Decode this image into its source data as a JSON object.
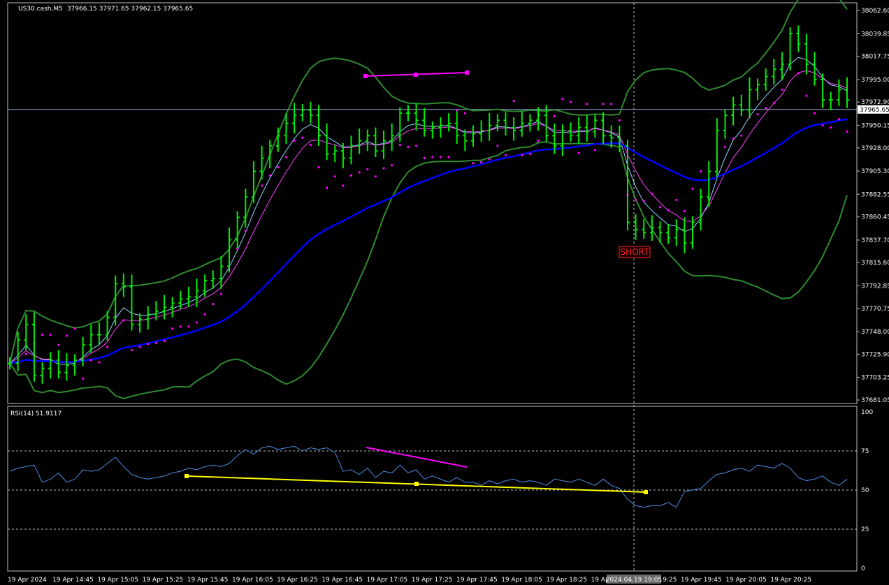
{
  "header": {
    "symbol": "US30.cash,M5",
    "ohlc": "37966.15 37971.65 37962.15 37965.65"
  },
  "rsi_header": "RSI(14) 51.9117",
  "signal_label": "SHORT",
  "crosshair_time": "2024.04.19 19:05",
  "colors": {
    "background": "#000000",
    "bars": "#00ee00",
    "bb_up": "#2e8b2e",
    "bb_down": "#ff0000",
    "ma_fast": "#8fd8ff",
    "ma_mid": "#ff40ff",
    "ma_slow": "#0000ff",
    "psar": "#ff00ff",
    "rsi_line": "#4a90e2",
    "trend_up": "#ff00ff",
    "trend_rsi": "#ffff00"
  },
  "chart_data": [
    {
      "type": "line",
      "title": "US30.cash,M5",
      "price_ticks": [
        "38062.60",
        "38039.85",
        "38017.75",
        "37995.00",
        "37972.90",
        "37950.15",
        "37928.00",
        "37905.30",
        "37882.55",
        "37860.45",
        "37837.70",
        "37815.60",
        "37792.85",
        "37770.75",
        "37748.00",
        "37725.90",
        "37703.25",
        "37681.05"
      ],
      "current_price": "37965.65",
      "ylim": [
        37681.05,
        38062.6
      ],
      "x_ticks": [
        "19 Apr 2024",
        "19 Apr 14:45",
        "19 Apr 15:05",
        "19 Apr 15:25",
        "19 Apr 15:45",
        "19 Apr 16:05",
        "19 Apr 16:25",
        "19 Apr 16:45",
        "19 Apr 17:05",
        "19 Apr 17:25",
        "19 Apr 17:45",
        "19 Apr 18:05",
        "19 Apr 18:25",
        "19 Apr 19:05",
        "19 Apr 19:25",
        "19 Apr 19:45",
        "19 Apr 20:05",
        "19 Apr 20:25"
      ],
      "series": [
        {
          "values": [
            37717,
            37740,
            37755,
            37705,
            37712,
            37720,
            37708,
            37715,
            37720,
            37735,
            37745,
            37745,
            37762,
            37795,
            37792,
            37755,
            37760,
            37765,
            37768,
            37772,
            37776,
            37780,
            37782,
            37788,
            37798,
            37800,
            37812,
            37838,
            37860,
            37880,
            37905,
            37918,
            37930,
            37940,
            37952,
            37960,
            37965,
            37960,
            37940,
            37922,
            37925,
            37918,
            37930,
            37935,
            37940,
            37925,
            37935,
            37940,
            37962,
            37962,
            37955,
            37945,
            37948,
            37950,
            37952,
            37940,
            37935,
            37942,
            37945,
            37950,
            37955,
            37948,
            37945,
            37952,
            37955,
            37960,
            37940,
            37930,
            37945,
            37940,
            37948,
            37944,
            37955,
            37940,
            37938,
            37930,
            37855,
            37848,
            37845,
            37850,
            37845,
            37840,
            37848,
            37835,
            37855,
            37880,
            37905,
            37945,
            37960,
            37970,
            37965,
            37985,
            37990,
            37998,
            38005,
            38010,
            38040,
            38030,
            38010,
            37995,
            37975,
            37975,
            37985,
            37975
          ]
        }
      ]
    },
    {
      "type": "line",
      "title": "RSI(14) 51.9117",
      "y_ticks": [
        "100",
        "75",
        "50",
        "25",
        "0"
      ],
      "ylim": [
        0,
        100
      ],
      "levels": [
        75,
        50,
        25
      ],
      "series": [
        {
          "values": [
            62,
            64,
            65,
            66,
            55,
            57,
            61,
            55,
            57,
            63,
            62,
            63,
            67,
            71,
            65,
            60,
            58,
            57,
            58,
            59,
            61,
            62,
            64,
            63,
            65,
            66,
            65,
            67,
            72,
            76,
            73,
            77,
            78,
            76,
            77,
            78,
            75,
            77,
            76,
            77,
            74,
            62,
            63,
            60,
            64,
            58,
            62,
            61,
            66,
            61,
            63,
            57,
            59,
            57,
            55,
            58,
            55,
            55,
            53,
            56,
            54,
            56,
            57,
            55,
            56,
            55,
            53,
            57,
            56,
            55,
            57,
            55,
            53,
            57,
            53,
            51,
            44,
            40,
            39,
            40,
            40,
            42,
            39,
            49,
            50,
            51,
            56,
            60,
            61,
            63,
            64,
            62,
            66,
            65,
            64,
            67,
            64,
            58,
            56,
            57,
            59,
            55,
            53,
            57
          ]
        }
      ]
    }
  ]
}
